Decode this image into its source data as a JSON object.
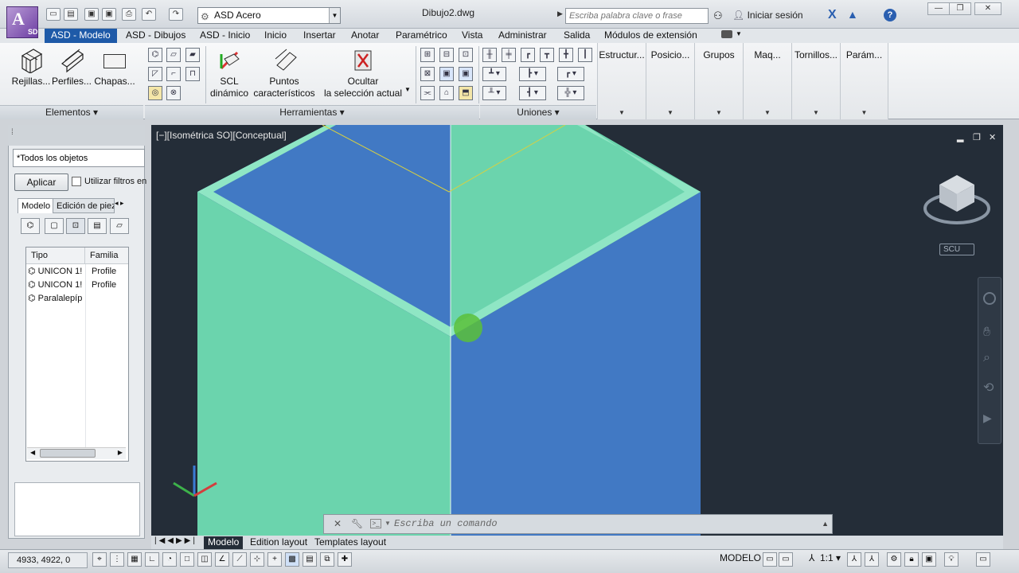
{
  "app": {
    "logo_text": "A",
    "logo_sub": "SD",
    "doc_title": "Dibujo2.dwg"
  },
  "workspace": {
    "value": "ASD Acero"
  },
  "search": {
    "placeholder": "Escriba palabra clave o frase"
  },
  "user": {
    "signin_label": "Iniciar sesión"
  },
  "tabs": [
    {
      "label": "ASD - Modelo",
      "active": true
    },
    {
      "label": "ASD - Dibujos"
    },
    {
      "label": "ASD - Inicio"
    },
    {
      "label": "Inicio"
    },
    {
      "label": "Insertar"
    },
    {
      "label": "Anotar"
    },
    {
      "label": "Paramétrico"
    },
    {
      "label": "Vista"
    },
    {
      "label": "Administrar"
    },
    {
      "label": "Salida"
    },
    {
      "label": "Módulos de extensión"
    }
  ],
  "ribbon": {
    "elementos": {
      "title": "Elementos",
      "buttons": [
        {
          "label": "Rejillas..."
        },
        {
          "label": "Perfiles..."
        },
        {
          "label": "Chapas..."
        }
      ]
    },
    "herramientas": {
      "title": "Herramientas",
      "scl": {
        "line1": "SCL",
        "line2": "dinámico"
      },
      "puntos": {
        "line1": "Puntos",
        "line2": "característicos"
      },
      "ocultar": {
        "line1": "Ocultar",
        "line2": "la selección actual"
      }
    },
    "uniones": {
      "title": "Uniones"
    },
    "collapsed": [
      {
        "label": "Estructur..."
      },
      {
        "label": "Posicio..."
      },
      {
        "label": "Grupos"
      },
      {
        "label": "Maq..."
      },
      {
        "label": "Tornillos..."
      },
      {
        "label": "Parám..."
      }
    ]
  },
  "palette": {
    "filter_value": "*Todos los objetos",
    "apply_label": "Aplicar",
    "use_filters_label": "Utilizar filtros en",
    "tabs": [
      {
        "label": "Modelo"
      },
      {
        "label": "Edición de piez"
      }
    ],
    "columns": [
      "Tipo",
      "Familia"
    ],
    "rows": [
      {
        "tipo": "UNICON 1!",
        "familia": "Profile"
      },
      {
        "tipo": "UNICON 1!",
        "familia": "Profile"
      },
      {
        "tipo": "Paralalepíp",
        "familia": ""
      }
    ]
  },
  "viewport": {
    "label": "[−][Isométrica SO][Conceptual]",
    "viewcube_scu": "SCU",
    "colors": {
      "bg": "#242d38",
      "green": "#6bd4ad",
      "blue": "#4179c4",
      "edge": "#8fe6c4"
    }
  },
  "command": {
    "placeholder": "Escriba un comando"
  },
  "layouts": [
    {
      "label": "Modelo",
      "active": true
    },
    {
      "label": "Edition layout"
    },
    {
      "label": "Templates layout"
    }
  ],
  "status": {
    "coords": "4933, 4922, 0",
    "model_label": "MODELO",
    "scale_label": "1:1"
  }
}
